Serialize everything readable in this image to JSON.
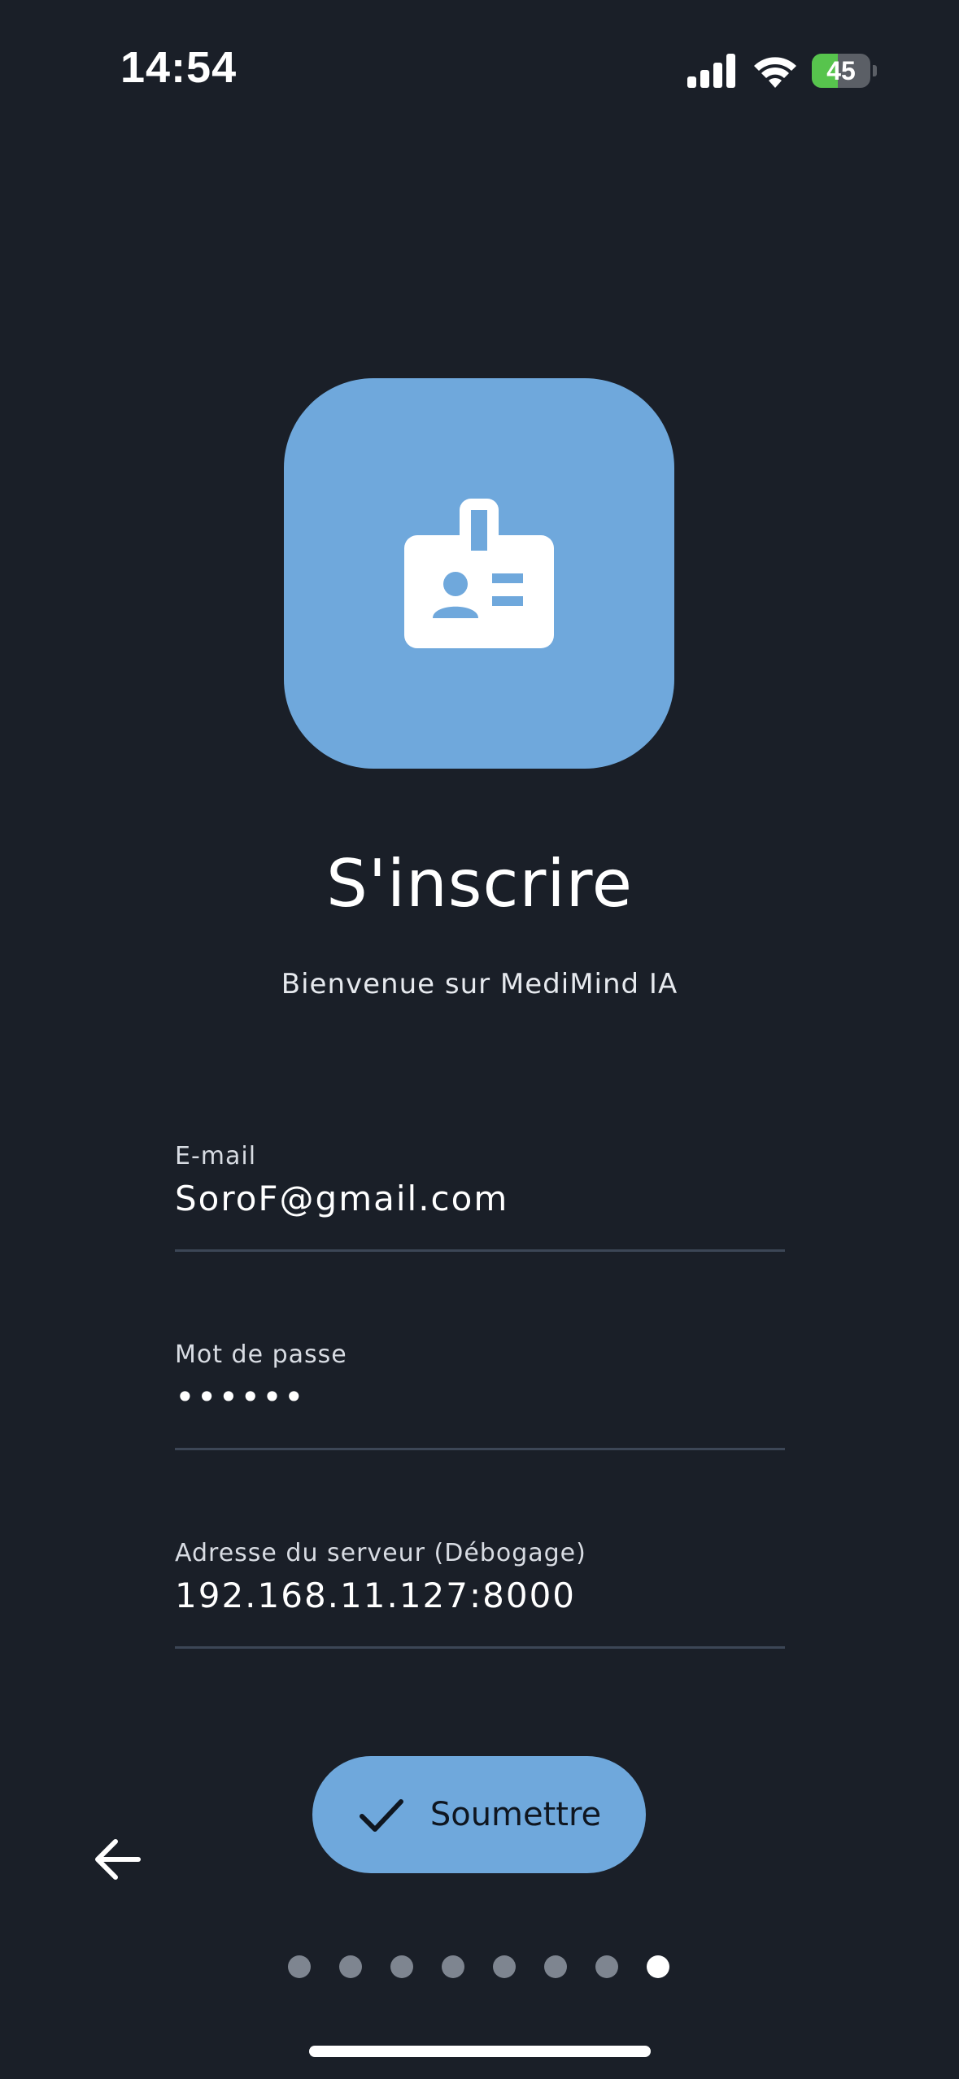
{
  "status_bar": {
    "time": "14:54",
    "battery_level": "45",
    "battery_fraction": 0.45,
    "signal_bars": 4,
    "icons": [
      "cellular-signal-icon",
      "wifi-icon",
      "battery-charging-icon"
    ]
  },
  "header": {
    "icon": "id-badge-icon",
    "title": "S'inscrire",
    "subtitle": "Bienvenue sur MediMind IA"
  },
  "form": {
    "email": {
      "label": "E-mail",
      "value": "SoroF@gmail.com"
    },
    "password": {
      "label": "Mot de passe",
      "value": "••••••"
    },
    "server": {
      "label": "Adresse du serveur (Débogage)",
      "value": "192.168.11.127:8000"
    },
    "submit_label": "Soumettre",
    "submit_icon": "check-icon"
  },
  "navigation": {
    "back_icon": "arrow-left-icon",
    "page_count": 8,
    "current_page": 8
  },
  "colors": {
    "background": "#1a1f28",
    "accent": "#6fa8dc",
    "battery": "#57c44d",
    "dot_inactive": "#7e8590",
    "dot_active": "#ffffff"
  }
}
